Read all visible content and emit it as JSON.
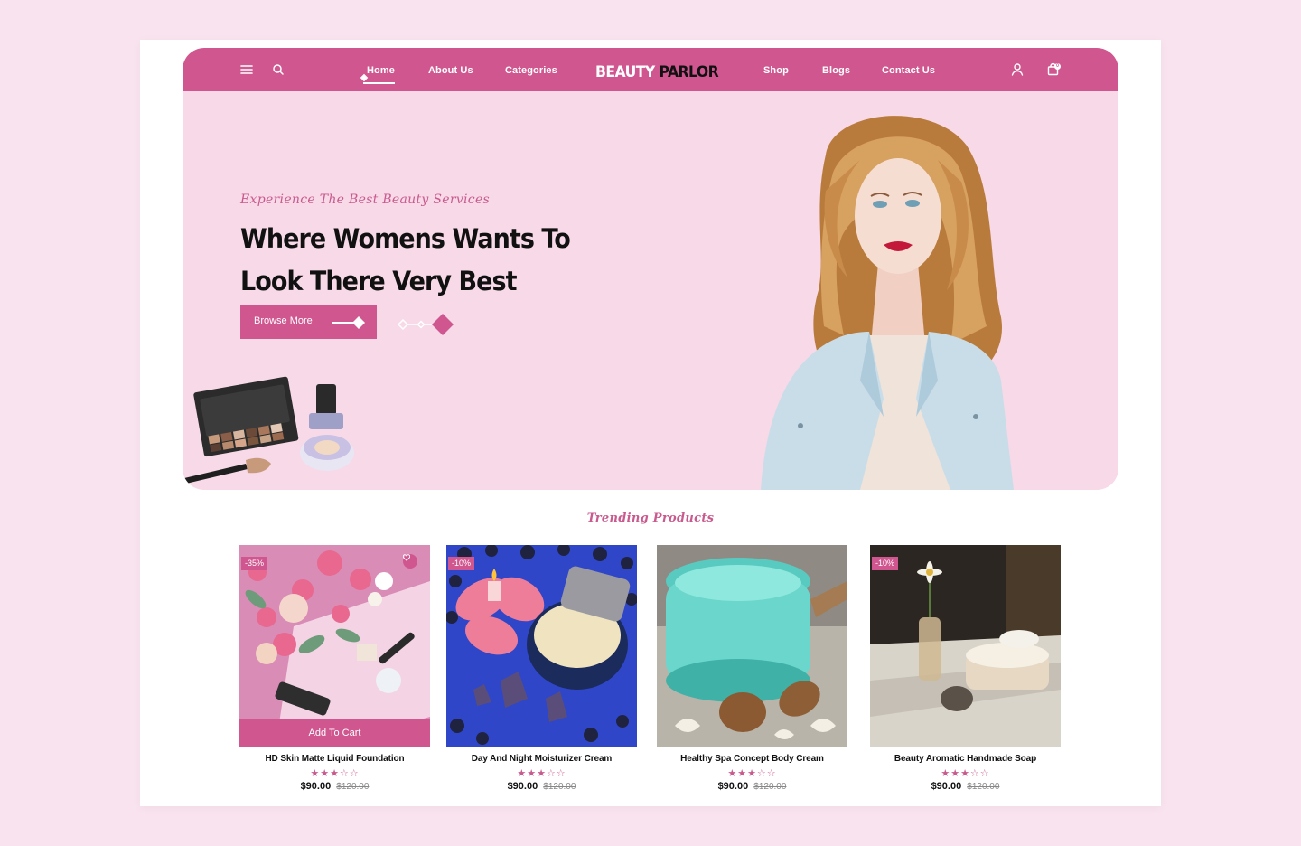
{
  "header": {
    "logo_part1": "BEAUTY",
    "logo_part2": "PARLOR",
    "nav_left": [
      {
        "label": "Home",
        "active": true
      },
      {
        "label": "About Us"
      },
      {
        "label": "Categories"
      }
    ],
    "nav_right": [
      {
        "label": "Shop"
      },
      {
        "label": "Blogs"
      },
      {
        "label": "Contact Us"
      }
    ],
    "cart_count": "0",
    "icons": [
      "menu-icon",
      "search-icon",
      "user-icon",
      "cart-icon"
    ]
  },
  "hero": {
    "tagline": "Experience The Best Beauty Services",
    "title_line1": "Where Womens Wants To",
    "title_line2": "Look There Very Best",
    "button_label": "Browse More"
  },
  "trending": {
    "title": "Trending Products",
    "add_to_cart_label": "Add To Cart",
    "products": [
      {
        "name": "HD Skin Matte Liquid Foundation",
        "badge": "-35%",
        "rating": 3,
        "stars": "★★★☆☆",
        "price": "$90.00",
        "old_price": "$120.00"
      },
      {
        "name": "Day And Night Moisturizer Cream",
        "badge": "-10%",
        "rating": 3,
        "stars": "★★★☆☆",
        "price": "$90.00",
        "old_price": "$120.00"
      },
      {
        "name": "Healthy Spa Concept Body Cream",
        "badge": "",
        "rating": 3,
        "stars": "★★★☆☆",
        "price": "$90.00",
        "old_price": "$120.00"
      },
      {
        "name": "Beauty Aromatic Handmade Soap",
        "badge": "-10%",
        "rating": 3,
        "stars": "★★★☆☆",
        "price": "$90.00",
        "old_price": "$120.00"
      }
    ]
  },
  "colors": {
    "brand": "#d0568f",
    "hero_bg": "#f7d9e8",
    "page_bg": "#f9e3ee"
  }
}
